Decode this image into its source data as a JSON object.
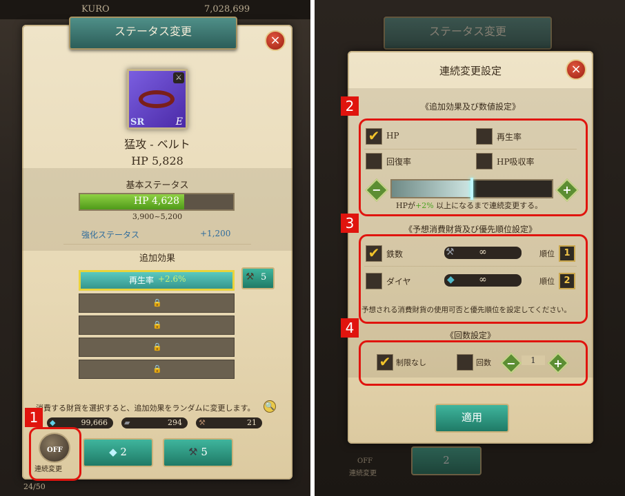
{
  "left": {
    "topbar": {
      "player": "KURO",
      "money": "7,028,699"
    },
    "title": "ステータス変更",
    "item": {
      "name": "猛攻 - ベルト",
      "hp": "HP 5,828",
      "rarity": "SR",
      "grade": "E"
    },
    "base": {
      "header": "基本ステータス",
      "bar_label": "HP 4,628",
      "range": "3,900~5,200",
      "fill_fraction": 0.68
    },
    "enhance": {
      "label": "強化ステータス",
      "value": "+1,200"
    },
    "extra": {
      "header": "追加効果",
      "effect_name": "再生率",
      "effect_value": "+2.6%",
      "hammer_count": "5"
    },
    "notice": "消費する財貨を選択すると、追加効果をランダムに変更します。",
    "resources": {
      "diamond": "99,666",
      "iron": "294",
      "hammer": "21"
    },
    "buttons": {
      "toggle_state": "OFF",
      "toggle_label": "連続変更",
      "diamond_cost": "2",
      "iron_cost": "5"
    },
    "callout": "1",
    "footer": "24/50"
  },
  "right": {
    "bg_title": "ステータス変更",
    "title": "連続変更設定",
    "sec1": {
      "header": "《追加効果及び数値設定》",
      "options": [
        {
          "label": "HP",
          "checked": true
        },
        {
          "label": "再生率",
          "checked": false
        },
        {
          "label": "回復率",
          "checked": false
        },
        {
          "label": "HP吸収率",
          "checked": false
        }
      ],
      "slider_fraction": 0.5,
      "condition_pre": "HPが",
      "condition_value": "+2%",
      "condition_post": " 以上になるまで連続変更する。"
    },
    "sec2": {
      "header": "《予想消費財貨及び優先順位設定》",
      "rows": [
        {
          "label": "鉄数",
          "checked": true,
          "value": "∞",
          "rank_label": "順位",
          "rank": "1"
        },
        {
          "label": "ダイヤ",
          "checked": false,
          "value": "∞",
          "rank_label": "順位",
          "rank": "2"
        }
      ],
      "note": "予想される消費財貨の使用可否と優先順位を設定してください。"
    },
    "sec3": {
      "header": "《回数設定》",
      "unlimited": "制限なし",
      "unlimited_checked": true,
      "count_label": "回数",
      "count_value": "1"
    },
    "apply": "適用",
    "callouts": [
      "2",
      "3",
      "4"
    ],
    "bg_buttons": {
      "toggle_state": "OFF",
      "toggle_label": "連続変更",
      "diamond_cost": "2"
    }
  },
  "colors": {
    "accent_green": "#6ab82e",
    "callout_red": "#e0140e",
    "gold": "#f2c32b"
  }
}
